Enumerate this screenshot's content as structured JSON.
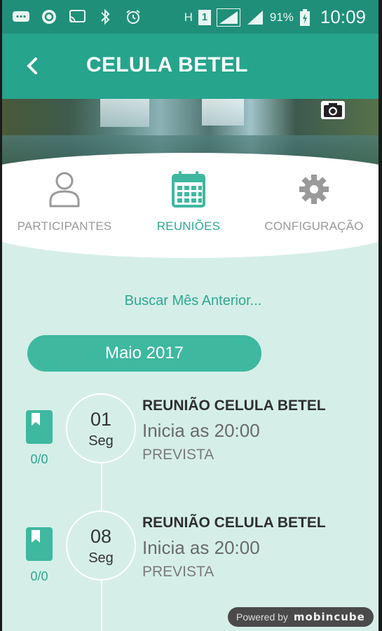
{
  "status_bar": {
    "battery_percent": "91%",
    "network_h": "H",
    "sim_slot": "1",
    "time": "10:09",
    "icons": [
      "message-icon",
      "sync-icon",
      "cast-icon",
      "bluetooth-icon",
      "alarm-icon",
      "signal-icon",
      "battery-icon"
    ]
  },
  "app_bar": {
    "title": "CELULA BETEL",
    "back_icon": "chevron-left-icon"
  },
  "cover": {
    "camera_icon": "camera-icon"
  },
  "tabs": [
    {
      "label": "PARTICIPANTES",
      "icon": "person-icon",
      "active": false
    },
    {
      "label": "REUNIÕES",
      "icon": "calendar-icon",
      "active": true
    },
    {
      "label": "CONFIGURAÇÃO",
      "icon": "gear-icon",
      "active": false
    }
  ],
  "previous_month_link": "Buscar Mês Anterior...",
  "month_label": "Maio 2017",
  "meetings": [
    {
      "day": "01",
      "weekday": "Seg",
      "title": "REUNIÃO CELULA BETEL",
      "time": "Inicia as 20:00",
      "status": "PREVISTA",
      "count": "0/0"
    },
    {
      "day": "08",
      "weekday": "Seg",
      "title": "REUNIÃO CELULA BETEL",
      "time": "Inicia as 20:00",
      "status": "PREVISTA",
      "count": "0/0"
    }
  ],
  "footer": {
    "powered_by": "Powered by",
    "brand": "mobincube"
  },
  "colors": {
    "status_bar": "#1f8f7a",
    "app_bar": "#26a48c",
    "accent": "#3fb8a0",
    "background": "#d5efe8"
  }
}
